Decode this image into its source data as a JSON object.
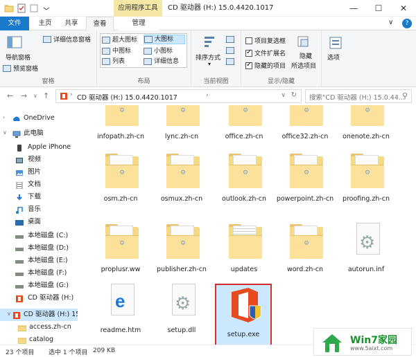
{
  "titlebar": {
    "app_tools": "应用程序工具",
    "title": "CD 驱动器 (H:) 15.0.4420.1017",
    "minimize": "—",
    "maximize": "☐",
    "close": "✕"
  },
  "tabs": {
    "file": "文件",
    "home": "主页",
    "share": "共享",
    "view": "查看",
    "manage": "管理",
    "help": "?"
  },
  "ribbon": {
    "pane": {
      "nav_pane": "导航窗格",
      "details_pane": "详细信息窗格",
      "preview_pane": "预览窗格",
      "label": "窗格"
    },
    "layout": {
      "extra_large": "超大图标",
      "large": "大图标",
      "medium": "中图标",
      "small": "小图标",
      "list": "列表",
      "details": "详细信息",
      "label": "布局"
    },
    "current_view": {
      "sort": "排序方式",
      "label": "当前视图"
    },
    "show_hide": {
      "item_checkboxes": "项目复选框",
      "file_ext": "文件扩展名",
      "hidden_items": "隐藏的项目",
      "hide_selected": "隐藏",
      "selected_items": "所选项目",
      "label": "显示/隐藏"
    },
    "options": "选项"
  },
  "address": {
    "path": "CD 驱动器 (H:) 15.0.4420.1017",
    "search_placeholder": "搜索\"CD 驱动器 (H:) 15.0.44..."
  },
  "navpane": [
    {
      "label": "OneDrive"
    },
    {
      "label": "此电脑"
    },
    {
      "label": "Apple iPhone"
    },
    {
      "label": "视频"
    },
    {
      "label": "图片"
    },
    {
      "label": "文档"
    },
    {
      "label": "下载"
    },
    {
      "label": "音乐"
    },
    {
      "label": "桌面"
    },
    {
      "label": "本地磁盘 (C:)"
    },
    {
      "label": "本地磁盘 (D:)"
    },
    {
      "label": "本地磁盘 (E:)"
    },
    {
      "label": "本地磁盘 (F:)"
    },
    {
      "label": "本地磁盘 (G:)"
    },
    {
      "label": "CD 驱动器 (H:)"
    },
    {
      "label": "CD 驱动器 (H:) 15"
    },
    {
      "label": "access.zh-cn"
    },
    {
      "label": "catalog"
    }
  ],
  "files": [
    {
      "name": "infopath.zh-cn",
      "kind": "folder"
    },
    {
      "name": "lync.zh-cn",
      "kind": "folder"
    },
    {
      "name": "office.zh-cn",
      "kind": "folder"
    },
    {
      "name": "office32.zh-cn",
      "kind": "folder"
    },
    {
      "name": "onenote.zh-cn",
      "kind": "folder"
    },
    {
      "name": "osm.zh-cn",
      "kind": "folder"
    },
    {
      "name": "osmux.zh-cn",
      "kind": "folder"
    },
    {
      "name": "outlook.zh-cn",
      "kind": "folder"
    },
    {
      "name": "powerpoint.zh-cn",
      "kind": "folder"
    },
    {
      "name": "proofing.zh-cn",
      "kind": "folder"
    },
    {
      "name": "proplusr.ww",
      "kind": "folder"
    },
    {
      "name": "publisher.zh-cn",
      "kind": "folder"
    },
    {
      "name": "updates",
      "kind": "folder-docs"
    },
    {
      "name": "word.zh-cn",
      "kind": "folder"
    },
    {
      "name": "autorun.inf",
      "kind": "gear-file"
    },
    {
      "name": "readme.htm",
      "kind": "edge-file"
    },
    {
      "name": "setup.dll",
      "kind": "gear-file"
    },
    {
      "name": "setup.exe",
      "kind": "office-exe",
      "selected": true
    }
  ],
  "status": {
    "count": "23 个项目",
    "selected": "选中 1 个项目",
    "size": "209 KB"
  },
  "watermark": {
    "brand": "Win7家园",
    "url": "www.5aixt.com"
  },
  "colors": {
    "file_tab": "#1979ca",
    "selection": "#cce8ff",
    "app_tools": "#f5e7a6",
    "folder": "#f6d984",
    "highlight_border": "#d42d2d"
  }
}
